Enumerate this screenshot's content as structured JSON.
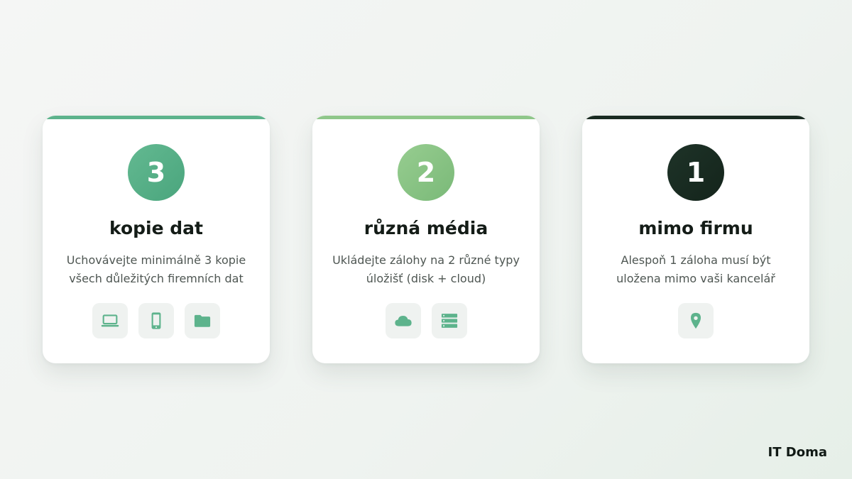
{
  "colors": {
    "accent_green": "#5db38c",
    "accent_light_green": "#8fc78a",
    "accent_dark": "#1a2b22",
    "icon_color": "#5db38c",
    "icon_tile_bg": "#eff2f0",
    "card_bg": "#ffffff"
  },
  "cards": [
    {
      "number": "3",
      "title": "kopie dat",
      "description": "Uchovávejte minimálně 3 kopie všech důležitých firemních dat",
      "icons": [
        "laptop-icon",
        "phone-icon",
        "folder-icon"
      ]
    },
    {
      "number": "2",
      "title": "různá média",
      "description": "Ukládejte zálohy na 2 různé typy úložišť (disk + cloud)",
      "icons": [
        "cloud-icon",
        "server-icon"
      ]
    },
    {
      "number": "1",
      "title": "mimo firmu",
      "description": "Alespoň 1 záloha musí být uložena mimo vaši kancelář",
      "icons": [
        "location-pin-icon"
      ]
    }
  ],
  "brand": {
    "name": "IT Doma"
  }
}
